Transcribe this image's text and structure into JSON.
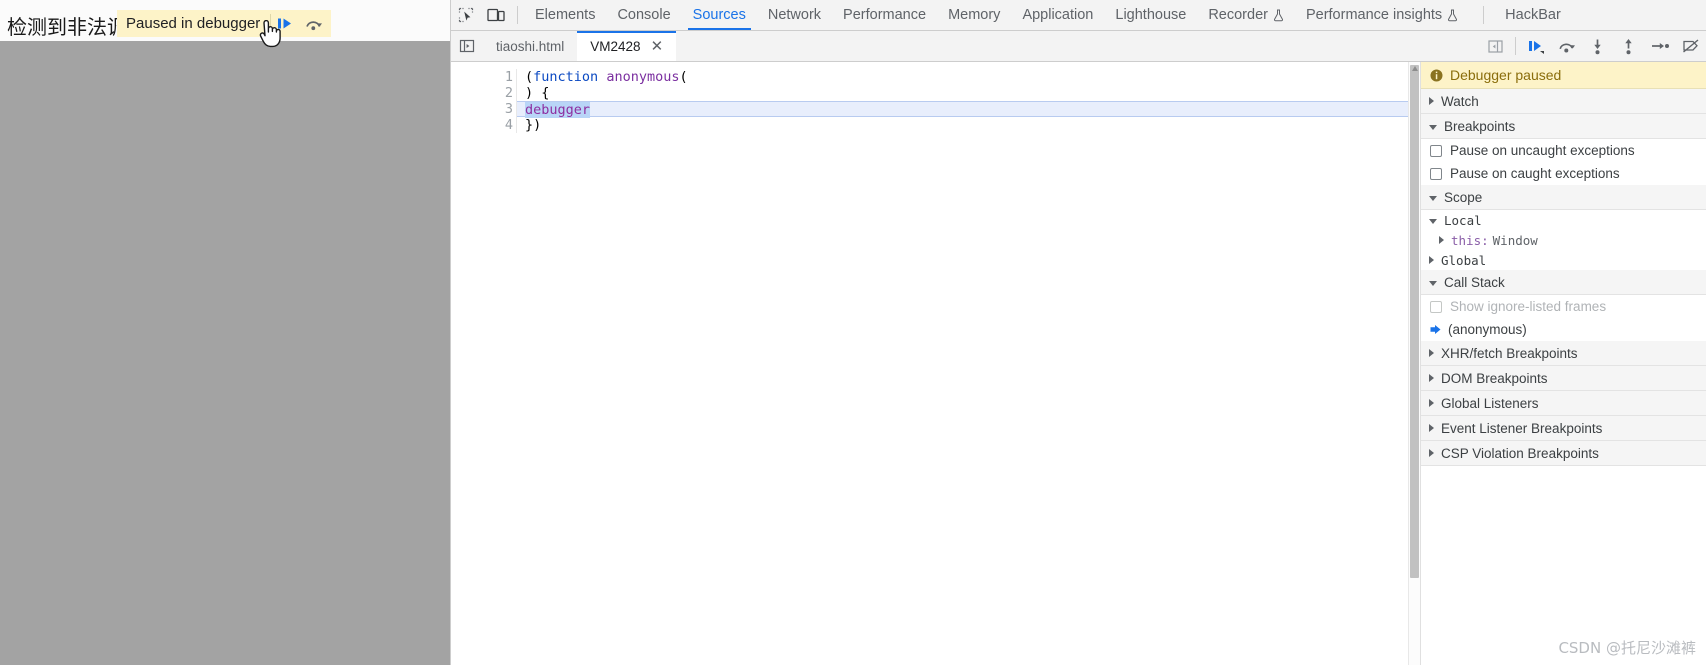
{
  "page": {
    "warning_text": "检测到非法调",
    "paused_overlay": {
      "message": "Paused in debugger",
      "resume_icon": "resume-script-icon",
      "step_over_icon": "step-over-icon"
    },
    "cursor_icon": "pointer-hand-cursor"
  },
  "devtools": {
    "toolbar": {
      "inspect_icon": "inspect-element-icon",
      "device_icon": "toggle-device-toolbar-icon",
      "tabs": [
        {
          "label": "Elements",
          "selected": false,
          "experimental": false
        },
        {
          "label": "Console",
          "selected": false,
          "experimental": false
        },
        {
          "label": "Sources",
          "selected": true,
          "experimental": false
        },
        {
          "label": "Network",
          "selected": false,
          "experimental": false
        },
        {
          "label": "Performance",
          "selected": false,
          "experimental": false
        },
        {
          "label": "Memory",
          "selected": false,
          "experimental": false
        },
        {
          "label": "Application",
          "selected": false,
          "experimental": false
        },
        {
          "label": "Lighthouse",
          "selected": false,
          "experimental": false
        },
        {
          "label": "Recorder",
          "selected": false,
          "experimental": true
        },
        {
          "label": "Performance insights",
          "selected": false,
          "experimental": true
        }
      ],
      "extension_tab": {
        "label": "HackBar"
      },
      "accent_color": "#1a73e8"
    },
    "sources_subbar": {
      "navigator_toggle_icon": "show-navigator-icon",
      "file_tabs": [
        {
          "label": "tiaoshi.html",
          "active": false,
          "closable": false
        },
        {
          "label": "VM2428",
          "active": true,
          "closable": true,
          "close_label": "✕"
        }
      ],
      "sidebar_toggle_icon": "show-debugger-sidebar-icon",
      "debug_buttons": [
        {
          "name": "resume-script-execution",
          "icon": "resume-icon"
        },
        {
          "name": "step-over-next-call",
          "icon": "step-over-icon"
        },
        {
          "name": "step-into-next-call",
          "icon": "step-into-icon"
        },
        {
          "name": "step-out-of-current-function",
          "icon": "step-out-icon"
        },
        {
          "name": "step",
          "icon": "step-icon"
        },
        {
          "name": "deactivate-breakpoints",
          "icon": "deactivate-breakpoints-icon"
        }
      ]
    },
    "editor": {
      "line_numbers": [
        "1",
        "2",
        "3",
        "4"
      ],
      "lines": [
        {
          "tokens": [
            {
              "t": "(",
              "c": "plain"
            },
            {
              "t": "function",
              "c": "kw"
            },
            {
              "t": " ",
              "c": "plain"
            },
            {
              "t": "anonymous",
              "c": "fn"
            },
            {
              "t": "(",
              "c": "plain"
            }
          ]
        },
        {
          "tokens": [
            {
              "t": ") {",
              "c": "plain"
            }
          ]
        },
        {
          "tokens": [
            {
              "t": "debugger",
              "c": "sel"
            }
          ],
          "executing": true
        },
        {
          "tokens": [
            {
              "t": "})",
              "c": "plain"
            }
          ]
        }
      ],
      "scrollbar": {
        "name": "editor-vertical-scrollbar"
      }
    },
    "sidebar": {
      "paused_banner": {
        "icon": "info-icon",
        "text": "Debugger paused"
      },
      "sections": [
        {
          "type": "header",
          "label": "Watch",
          "expanded": false,
          "name": "watch-section"
        },
        {
          "type": "header",
          "label": "Breakpoints",
          "expanded": true,
          "name": "breakpoints-section"
        },
        {
          "type": "checkbox",
          "label": "Pause on uncaught exceptions",
          "checked": false,
          "disabled": false,
          "name": "pause-on-uncaught-exceptions-checkbox"
        },
        {
          "type": "checkbox",
          "label": "Pause on caught exceptions",
          "checked": false,
          "disabled": false,
          "name": "pause-on-caught-exceptions-checkbox"
        },
        {
          "type": "header",
          "label": "Scope",
          "expanded": true,
          "name": "scope-section"
        },
        {
          "type": "scope",
          "label": "Local",
          "expanded": true,
          "indent": false,
          "name": "scope-local"
        },
        {
          "type": "scope-prop",
          "label": "this:",
          "value": "Window",
          "indent": true,
          "name": "scope-this-window"
        },
        {
          "type": "scope",
          "label": "Global",
          "expanded": false,
          "indent": false,
          "name": "scope-global"
        },
        {
          "type": "header",
          "label": "Call Stack",
          "expanded": true,
          "name": "call-stack-section"
        },
        {
          "type": "checkbox",
          "label": "Show ignore-listed frames",
          "checked": false,
          "disabled": true,
          "name": "show-ignore-listed-frames-checkbox"
        },
        {
          "type": "frame",
          "label": "(anonymous)",
          "current": true,
          "name": "call-stack-frame-anonymous"
        },
        {
          "type": "header",
          "label": "XHR/fetch Breakpoints",
          "expanded": false,
          "name": "xhr-fetch-breakpoints-section"
        },
        {
          "type": "header",
          "label": "DOM Breakpoints",
          "expanded": false,
          "name": "dom-breakpoints-section"
        },
        {
          "type": "header",
          "label": "Global Listeners",
          "expanded": false,
          "name": "global-listeners-section"
        },
        {
          "type": "header",
          "label": "Event Listener Breakpoints",
          "expanded": false,
          "name": "event-listener-breakpoints-section"
        },
        {
          "type": "header",
          "label": "CSP Violation Breakpoints",
          "expanded": false,
          "name": "csp-violation-breakpoints-section"
        }
      ]
    }
  },
  "watermark": {
    "prefix": "CSDN @",
    "author": "托尼沙滩裤"
  }
}
